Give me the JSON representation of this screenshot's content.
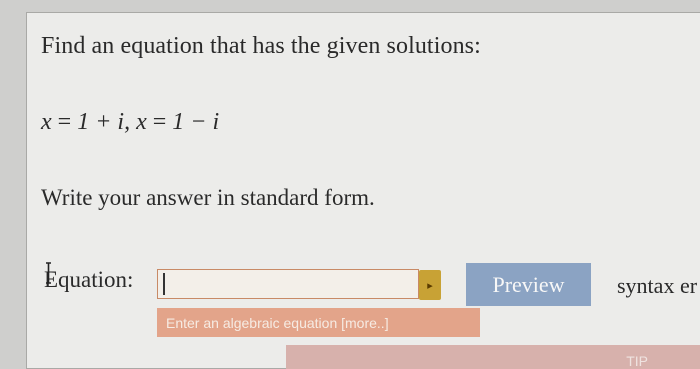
{
  "question": {
    "prompt": "Find an equation that has the given solutions:",
    "solutions": {
      "var1": "x",
      "eq1": "=",
      "expr1": "1 + i,",
      "var2": "x",
      "eq2": "=",
      "expr2": "1 − i"
    },
    "instruction": "Write your answer in standard form."
  },
  "answer": {
    "label": "Equation:",
    "value": "",
    "hint": "Enter an algebraic equation [more..]"
  },
  "buttons": {
    "preview_label": "Preview",
    "syntax_text": "syntax er",
    "tip_label": "TIP"
  },
  "icons": {
    "cursor": "text-cursor-icon",
    "editor_toggle": "math-editor-icon"
  },
  "colors": {
    "preview_button": "#8ba3c3",
    "hint_bar": "#e3a48a",
    "editor_toggle": "#c8a235"
  }
}
